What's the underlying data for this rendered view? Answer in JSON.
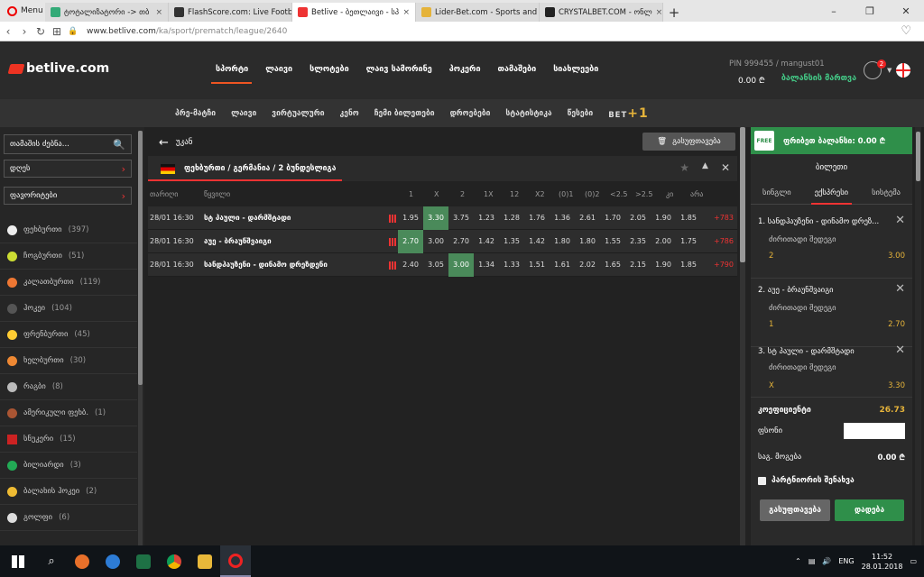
{
  "browser": {
    "menu": "Menu",
    "tabs": [
      {
        "label": "ტოტალიზატორი -> თბ",
        "color": "#3a7"
      },
      {
        "label": "FlashScore.com: Live Footb",
        "color": "#333"
      },
      {
        "label": "Betlive - ბეთლაივი - სპ",
        "color": "#e33"
      },
      {
        "label": "Lider-Bet.com - Sports and",
        "color": "#e5b33a"
      },
      {
        "label": "CRYSTALBET.COM - ონლ",
        "color": "#222"
      }
    ],
    "url_domain": "www.betlive.com",
    "url_path": "/ka/sport/prematch/league/2640"
  },
  "header": {
    "logo": "betlive.com",
    "nav": [
      "სპორტი",
      "ლაივი",
      "სლოტები",
      "ლაივ სამორინე",
      "პოკერი",
      "თამაშები",
      "სიახლეები"
    ],
    "account": "PIN 999455 / mangust01",
    "balance": "0.00 ₾",
    "deposit": "ბალანსის მართვა",
    "notif": "2"
  },
  "subnav": [
    "პრე-მატჩი",
    "ლაივი",
    "ვირტუალური",
    "კენო",
    "ჩემი ბილეთები",
    "დროებები",
    "სტატისტიკა",
    "წესები"
  ],
  "subnav_brand": "BET",
  "subnav_brand_plus": "+1",
  "left": {
    "search": "თამაშის ძებნა...",
    "today": "დღეს",
    "favorites": "ფავორიტები",
    "sports": [
      {
        "name": "ფეხბურთი",
        "count": "(397)",
        "color": "#eee"
      },
      {
        "name": "ჩოგბურთი",
        "count": "(51)",
        "color": "#cd3"
      },
      {
        "name": "კალათბურთი",
        "count": "(119)",
        "color": "#e73"
      },
      {
        "name": "ჰოკეი",
        "count": "(104)",
        "color": "#555"
      },
      {
        "name": "ფრენბურთი",
        "count": "(45)",
        "color": "#fc3"
      },
      {
        "name": "ხელბურთი",
        "count": "(30)",
        "color": "#e83"
      },
      {
        "name": "რაგბი",
        "count": "(8)",
        "color": "#bbb"
      },
      {
        "name": "ამერიკული ფეხბ.",
        "count": "(1)",
        "color": "#a53"
      },
      {
        "name": "სნუკერი",
        "count": "(15)",
        "color": "#c22"
      },
      {
        "name": "ბილიარდი",
        "count": "(3)",
        "color": "#2a5"
      },
      {
        "name": "ბალახის ჰოკეი",
        "count": "(2)",
        "color": "#eb3"
      },
      {
        "name": "გოლფი",
        "count": "(6)",
        "color": "#ddd"
      }
    ]
  },
  "center": {
    "back": "უკან",
    "clear": "გასუფთავება",
    "league": "ფეხბურთი / გერმანია / 2 ბუნდესლიგა",
    "headers": {
      "date": "თარიღი",
      "event": "წყვილი",
      "c1": "1",
      "cx": "X",
      "c2": "2",
      "c1x": "1X",
      "c12": "12",
      "cx2": "X2",
      "h1": "(0)1",
      "h2": "(0)2",
      "u": "<2.5",
      "o": ">2.5",
      "k": "კი",
      "n": "არა"
    },
    "rows": [
      {
        "date": "28/01 16:30",
        "event": "სტ პაული - დარმშტადი",
        "o": [
          "1.95",
          "3.30",
          "3.75",
          "1.23",
          "1.28",
          "1.76",
          "1.36",
          "2.61",
          "1.70",
          "2.05",
          "1.90",
          "1.85"
        ],
        "more": "+783",
        "hi": 1
      },
      {
        "date": "28/01 16:30",
        "event": "აუე - ბრაუნშვაიგი",
        "o": [
          "2.70",
          "3.00",
          "2.70",
          "1.42",
          "1.35",
          "1.42",
          "1.80",
          "1.80",
          "1.55",
          "2.35",
          "2.00",
          "1.75"
        ],
        "more": "+786",
        "hi": 0
      },
      {
        "date": "28/01 16:30",
        "event": "სანდჰაუზენი - დინამო დრეზდენი",
        "o": [
          "2.40",
          "3.05",
          "3.00",
          "1.34",
          "1.33",
          "1.51",
          "1.61",
          "2.02",
          "1.65",
          "2.15",
          "1.90",
          "1.85"
        ],
        "more": "+790",
        "hi": 2
      }
    ]
  },
  "slip": {
    "free": "FREE",
    "freebal": "ფრიბეთ ბალანსი: 0.00 ₾",
    "title": "ბილეთი",
    "tabs": [
      "სინგლი",
      "ექსპრესი",
      "სისტემა"
    ],
    "bets": [
      {
        "title": "1. სანდჰაუზენი - დინამო დრეზ...",
        "market": "ძირითადი შედეგი",
        "outcome": "2",
        "odd": "3.00"
      },
      {
        "title": "2. აუე - ბრაუნშვაიგი",
        "market": "ძირითადი შედეგი",
        "outcome": "1",
        "odd": "2.70"
      },
      {
        "title": "3. სტ პაული - დარმშტადი",
        "market": "ძირითადი შედეგი",
        "outcome": "X",
        "odd": "3.30"
      }
    ],
    "coef_label": "კოეფიციენტი",
    "coef": "26.73",
    "stake_label": "ფსონი",
    "win_label": "საგ. მოგება",
    "win": "0.00 ₾",
    "save": "პარტნიორის შენახვა",
    "btn_clear": "გასუფთავება",
    "btn_bet": "დადება"
  },
  "taskbar": {
    "lang": "ENG",
    "time": "11:52",
    "date": "28.01.2018"
  }
}
